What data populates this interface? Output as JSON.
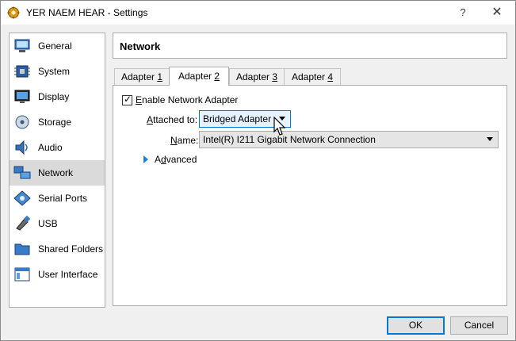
{
  "window": {
    "title": "YER NAEM HEAR - Settings",
    "help_label": "?",
    "close_label": "✕"
  },
  "sidebar": {
    "items": [
      {
        "label": "General",
        "icon": "monitor-icon"
      },
      {
        "label": "System",
        "icon": "chip-icon"
      },
      {
        "label": "Display",
        "icon": "display-icon"
      },
      {
        "label": "Storage",
        "icon": "disk-icon"
      },
      {
        "label": "Audio",
        "icon": "speaker-icon"
      },
      {
        "label": "Network",
        "icon": "network-icon",
        "active": true
      },
      {
        "label": "Serial Ports",
        "icon": "serial-port-icon"
      },
      {
        "label": "USB",
        "icon": "usb-icon"
      },
      {
        "label": "Shared Folders",
        "icon": "folder-icon"
      },
      {
        "label": "User Interface",
        "icon": "ui-icon"
      }
    ]
  },
  "main": {
    "section_title": "Network",
    "tabs": [
      {
        "pre": "Adapter ",
        "key": "1"
      },
      {
        "pre": "Adapter ",
        "key": "2",
        "active": true
      },
      {
        "pre": "Adapter ",
        "key": "3"
      },
      {
        "pre": "Adapter ",
        "key": "4"
      }
    ],
    "enable": {
      "pre": "",
      "key": "E",
      "post": "nable Network Adapter",
      "checked": true
    },
    "attached": {
      "pre": "",
      "key": "A",
      "post": "ttached to:",
      "value": "Bridged Adapter"
    },
    "name": {
      "pre": "",
      "key": "N",
      "post": "ame:",
      "value": "Intel(R) I211 Gigabit Network Connection"
    },
    "advanced": {
      "pre": "A",
      "key": "d",
      "post": "vanced"
    }
  },
  "buttons": {
    "ok": "OK",
    "cancel": "Cancel"
  },
  "colors": {
    "accent": "#0078d7",
    "active_item": "#dadada"
  }
}
